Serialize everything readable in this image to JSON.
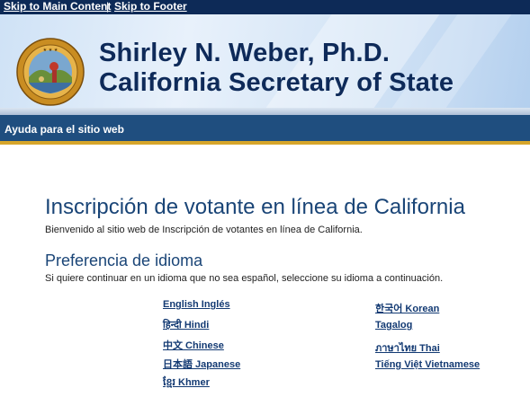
{
  "skip_links": {
    "main_content": "Skip to Main Content",
    "separator": "|",
    "footer": "Skip to Footer"
  },
  "header": {
    "title_line1": "Shirley N. Weber, Ph.D.",
    "title_line2": "California Secretary of State",
    "colors": {
      "title": "#0e2a59",
      "skip_bar": "#0d2a57",
      "nav_bar": "#1f4e7f",
      "accent": "#d6a52a"
    }
  },
  "nav": {
    "help_link": "Ayuda para el sitio web"
  },
  "main": {
    "page_title": "Inscripción de votante en línea de California",
    "welcome_text": "Bienvenido al sitio web de Inscripción de votantes en línea de California.",
    "section_title": "Preferencia de idioma",
    "instruction": "Si quiere continuar en un idioma que no sea español, seleccione su idioma a continuación."
  },
  "languages": {
    "left": [
      "English Inglés",
      "हिन्दी Hindi",
      "中文 Chinese",
      "日本語 Japanese",
      "ខ្មែរ Khmer"
    ],
    "right": [
      "한국어 Korean",
      "Tagalog",
      "ภาษาไทย Thai",
      "Tiếng Việt Vietnamese"
    ]
  }
}
